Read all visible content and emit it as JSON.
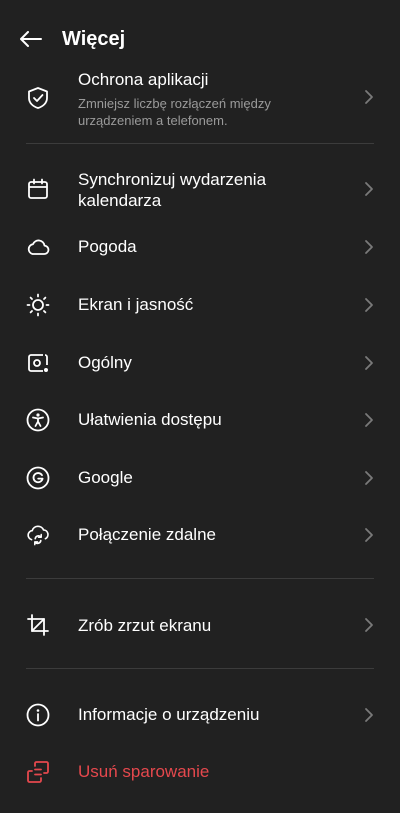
{
  "header": {
    "title": "Więcej"
  },
  "items": [
    {
      "label": "Ochrona aplikacji",
      "sublabel": "Zmniejsz liczbę rozłączeń między urządzeniem a telefonem.",
      "icon": "shield-check-icon"
    },
    {
      "label": "Synchronizuj wydarzenia kalendarza",
      "icon": "calendar-icon"
    },
    {
      "label": "Pogoda",
      "icon": "cloud-icon"
    },
    {
      "label": "Ekran i jasność",
      "icon": "brightness-icon"
    },
    {
      "label": "Ogólny",
      "icon": "general-settings-icon"
    },
    {
      "label": "Ułatwienia dostępu",
      "icon": "accessibility-icon"
    },
    {
      "label": "Google",
      "icon": "google-icon"
    },
    {
      "label": "Połączenie zdalne",
      "icon": "remote-connection-icon"
    },
    {
      "label": "Zrób zrzut ekranu",
      "icon": "screenshot-crop-icon"
    },
    {
      "label": "Informacje o urządzeniu",
      "icon": "info-icon"
    },
    {
      "label": "Usuń sparowanie",
      "icon": "unpair-icon"
    }
  ],
  "colors": {
    "background": "#212121",
    "text": "#ffffff",
    "secondary_text": "#9a9a9a",
    "danger": "#e5484d",
    "divider": "#3c3c3c"
  }
}
